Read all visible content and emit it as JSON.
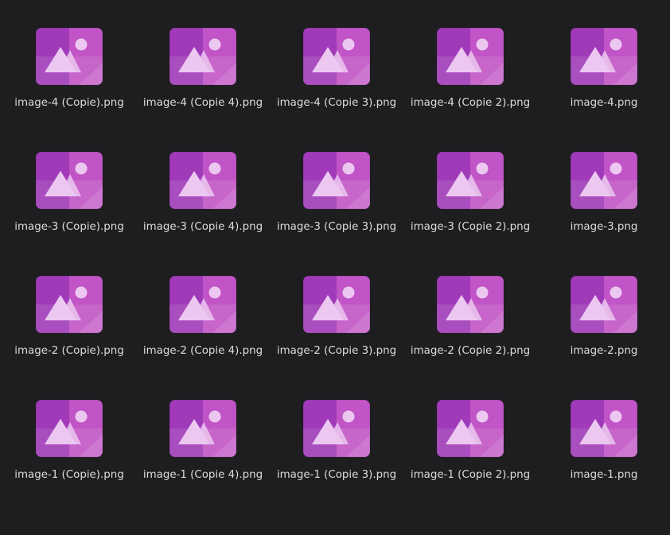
{
  "window": {
    "view": "file-manager icon grid",
    "background": "#1e1e20"
  },
  "icon": {
    "type": "image-file-icon",
    "color_left": "#a03ab8",
    "color_right": "#c154c6",
    "color_highlight": "#ecc8f1"
  },
  "rows": [
    [
      "image-4 (Copie).png",
      "image-4 (Copie 4).png",
      "image-4 (Copie 3).png",
      "image-4 (Copie 2).png",
      "image-4.png"
    ],
    [
      "image-3 (Copie).png",
      "image-3 (Copie 4).png",
      "image-3 (Copie 3).png",
      "image-3 (Copie 2).png",
      "image-3.png"
    ],
    [
      "image-2 (Copie).png",
      "image-2 (Copie 4).png",
      "image-2 (Copie 3).png",
      "image-2 (Copie 2).png",
      "image-2.png"
    ],
    [
      "image-1 (Copie).png",
      "image-1 (Copie 4).png",
      "image-1 (Copie 3).png",
      "image-1 (Copie 2).png",
      "image-1.png"
    ]
  ]
}
